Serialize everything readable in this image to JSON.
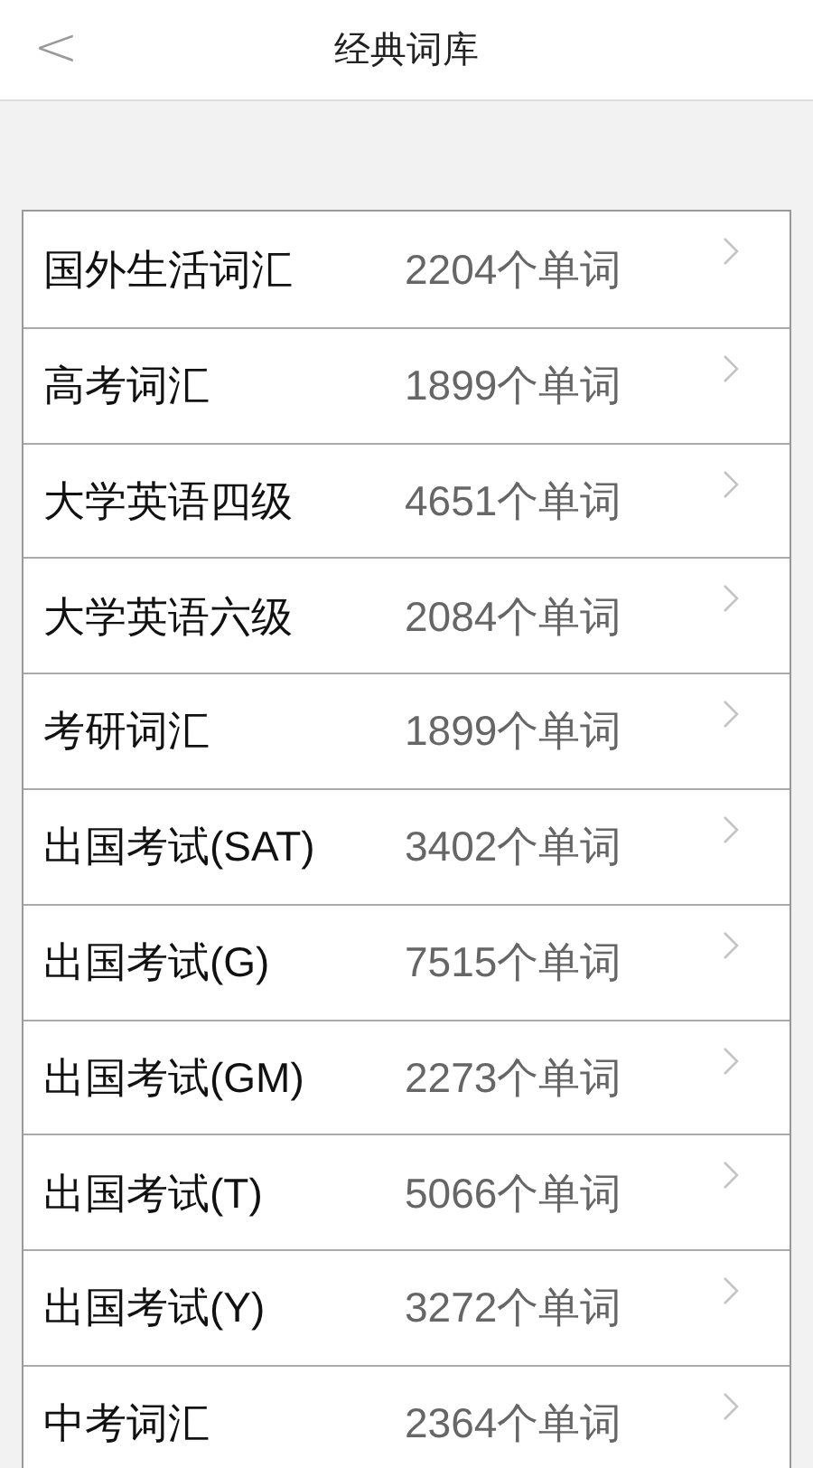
{
  "header": {
    "back": "<",
    "title": "经典词库"
  },
  "items": [
    {
      "name": "国外生活词汇",
      "count": "2204个单词"
    },
    {
      "name": "高考词汇",
      "count": "1899个单词"
    },
    {
      "name": "大学英语四级",
      "count": "4651个单词"
    },
    {
      "name": "大学英语六级",
      "count": "2084个单词"
    },
    {
      "name": "考研词汇",
      "count": "1899个单词"
    },
    {
      "name": "出国考试(SAT)",
      "count": "3402个单词"
    },
    {
      "name": "出国考试(G)",
      "count": "7515个单词"
    },
    {
      "name": "出国考试(GM)",
      "count": "2273个单词"
    },
    {
      "name": "出国考试(T)",
      "count": "5066个单词"
    },
    {
      "name": "出国考试(Y)",
      "count": "3272个单词"
    },
    {
      "name": "中考词汇",
      "count": "2364个单词"
    }
  ]
}
